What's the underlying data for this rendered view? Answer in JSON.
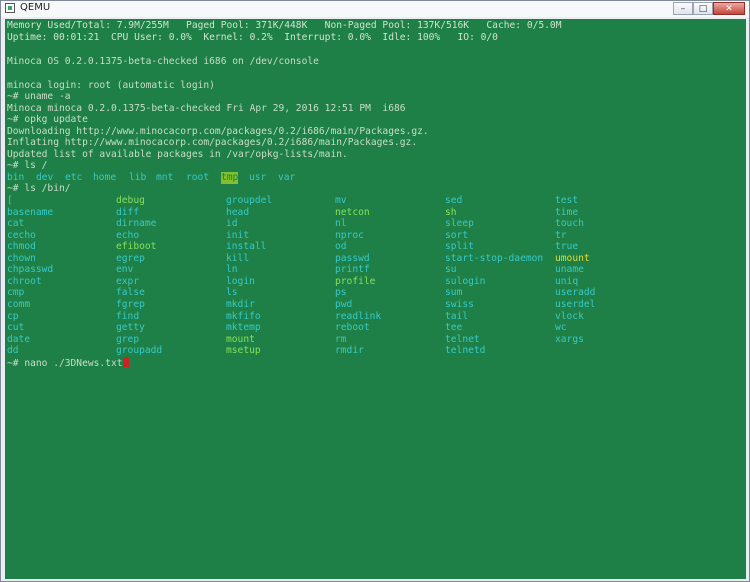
{
  "window": {
    "title": "QEMU",
    "controls": [
      "minimize-icon",
      "maximize-icon",
      "close-icon"
    ]
  },
  "terminal": {
    "header": [
      "Memory Used/Total: 7.9M/255M   Paged Pool: 371K/448K   Non-Paged Pool: 137K/516K   Cache: 0/5.0M",
      "Uptime: 00:01:21  CPU User: 0.0%  Kernel: 0.2%  Interrupt: 0.0%  Idle: 100%   IO: 0/0"
    ],
    "boot_message": "Minoca OS 0.2.0.1375-beta-checked i686 on /dev/console",
    "session": [
      "minoca login: root (automatic login)",
      "~# uname -a",
      "Minoca minoca 0.2.0.1375-beta-checked Fri Apr 29, 2016 12:51 PM  i686",
      "~# opkg update",
      "Downloading http://www.minocacorp.com/packages/0.2/i686/main/Packages.gz.",
      "Inflating http://www.minocacorp.com/packages/0.2/i686/main/Packages.gz.",
      "Updated list of available packages in /var/opkg-lists/main.",
      "~# ls /"
    ],
    "root_dirs": [
      {
        "name": "bin",
        "color": "#38c9c9"
      },
      {
        "name": "dev",
        "color": "#38c9c9"
      },
      {
        "name": "etc",
        "color": "#38c9c9"
      },
      {
        "name": "home",
        "color": "#38c9c9"
      },
      {
        "name": "lib",
        "color": "#38c9c9"
      },
      {
        "name": "mnt",
        "color": "#38c9c9"
      },
      {
        "name": "root",
        "color": "#38c9c9"
      },
      {
        "name": "tmp",
        "color": "#38c9c9",
        "highlight": true
      },
      {
        "name": "usr",
        "color": "#38c9c9"
      },
      {
        "name": "var",
        "color": "#38c9c9"
      }
    ],
    "ls_bin_command": "~# ls /bin/",
    "bin_columns": [
      [
        {
          "t": "[",
          "c": "cyan"
        },
        {
          "t": "basename",
          "c": "cyan"
        },
        {
          "t": "cat",
          "c": "cyan"
        },
        {
          "t": "cecho",
          "c": "cyan"
        },
        {
          "t": "chmod",
          "c": "cyan"
        },
        {
          "t": "chown",
          "c": "cyan"
        },
        {
          "t": "chpasswd",
          "c": "cyan"
        },
        {
          "t": "chroot",
          "c": "cyan"
        },
        {
          "t": "cmp",
          "c": "cyan"
        },
        {
          "t": "comm",
          "c": "cyan"
        },
        {
          "t": "cp",
          "c": "cyan"
        },
        {
          "t": "cut",
          "c": "cyan"
        },
        {
          "t": "date",
          "c": "cyan"
        },
        {
          "t": "dd",
          "c": "cyan"
        }
      ],
      [
        {
          "t": "debug",
          "c": "green"
        },
        {
          "t": "diff",
          "c": "cyan"
        },
        {
          "t": "dirname",
          "c": "cyan"
        },
        {
          "t": "echo",
          "c": "cyan"
        },
        {
          "t": "efiboot",
          "c": "green"
        },
        {
          "t": "egrep",
          "c": "cyan"
        },
        {
          "t": "env",
          "c": "cyan"
        },
        {
          "t": "expr",
          "c": "cyan"
        },
        {
          "t": "false",
          "c": "cyan"
        },
        {
          "t": "fgrep",
          "c": "cyan"
        },
        {
          "t": "find",
          "c": "cyan"
        },
        {
          "t": "getty",
          "c": "cyan"
        },
        {
          "t": "grep",
          "c": "cyan"
        },
        {
          "t": "groupadd",
          "c": "cyan"
        }
      ],
      [
        {
          "t": "groupdel",
          "c": "cyan"
        },
        {
          "t": "head",
          "c": "cyan"
        },
        {
          "t": "id",
          "c": "cyan"
        },
        {
          "t": "init",
          "c": "cyan"
        },
        {
          "t": "install",
          "c": "cyan"
        },
        {
          "t": "kill",
          "c": "cyan"
        },
        {
          "t": "ln",
          "c": "cyan"
        },
        {
          "t": "login",
          "c": "cyan"
        },
        {
          "t": "ls",
          "c": "cyan"
        },
        {
          "t": "mkdir",
          "c": "cyan"
        },
        {
          "t": "mkfifo",
          "c": "cyan"
        },
        {
          "t": "mktemp",
          "c": "cyan"
        },
        {
          "t": "mount",
          "c": "green"
        },
        {
          "t": "msetup",
          "c": "green"
        }
      ],
      [
        {
          "t": "mv",
          "c": "cyan"
        },
        {
          "t": "netcon",
          "c": "green"
        },
        {
          "t": "nl",
          "c": "cyan"
        },
        {
          "t": "nproc",
          "c": "cyan"
        },
        {
          "t": "od",
          "c": "cyan"
        },
        {
          "t": "passwd",
          "c": "cyan"
        },
        {
          "t": "printf",
          "c": "cyan"
        },
        {
          "t": "profile",
          "c": "green"
        },
        {
          "t": "ps",
          "c": "cyan"
        },
        {
          "t": "pwd",
          "c": "cyan"
        },
        {
          "t": "readlink",
          "c": "cyan"
        },
        {
          "t": "reboot",
          "c": "cyan"
        },
        {
          "t": "rm",
          "c": "cyan"
        },
        {
          "t": "rmdir",
          "c": "cyan"
        }
      ],
      [
        {
          "t": "sed",
          "c": "cyan"
        },
        {
          "t": "sh",
          "c": "green"
        },
        {
          "t": "sleep",
          "c": "cyan"
        },
        {
          "t": "sort",
          "c": "cyan"
        },
        {
          "t": "split",
          "c": "cyan"
        },
        {
          "t": "start-stop-daemon",
          "c": "cyan"
        },
        {
          "t": "su",
          "c": "cyan"
        },
        {
          "t": "sulogin",
          "c": "cyan"
        },
        {
          "t": "sum",
          "c": "cyan"
        },
        {
          "t": "swiss",
          "c": "cyan"
        },
        {
          "t": "tail",
          "c": "cyan"
        },
        {
          "t": "tee",
          "c": "cyan"
        },
        {
          "t": "telnet",
          "c": "cyan"
        },
        {
          "t": "telnetd",
          "c": "cyan"
        }
      ],
      [
        {
          "t": "test",
          "c": "cyan"
        },
        {
          "t": "time",
          "c": "cyan"
        },
        {
          "t": "touch",
          "c": "cyan"
        },
        {
          "t": "tr",
          "c": "cyan"
        },
        {
          "t": "true",
          "c": "cyan"
        },
        {
          "t": "umount",
          "c": "yellow"
        },
        {
          "t": "uname",
          "c": "cyan"
        },
        {
          "t": "uniq",
          "c": "cyan"
        },
        {
          "t": "useradd",
          "c": "cyan"
        },
        {
          "t": "userdel",
          "c": "cyan"
        },
        {
          "t": "vlock",
          "c": "cyan"
        },
        {
          "t": "wc",
          "c": "cyan"
        },
        {
          "t": "xargs",
          "c": "cyan"
        }
      ]
    ],
    "prompt_command": "~# nano ./3DNews.txt",
    "colors": {
      "background": "#1e8046",
      "text": "#c8ddc8",
      "cyan": "#38c9c9",
      "green": "#86e05a",
      "yellow": "#e2da35",
      "cursor": "#cc2222"
    }
  }
}
